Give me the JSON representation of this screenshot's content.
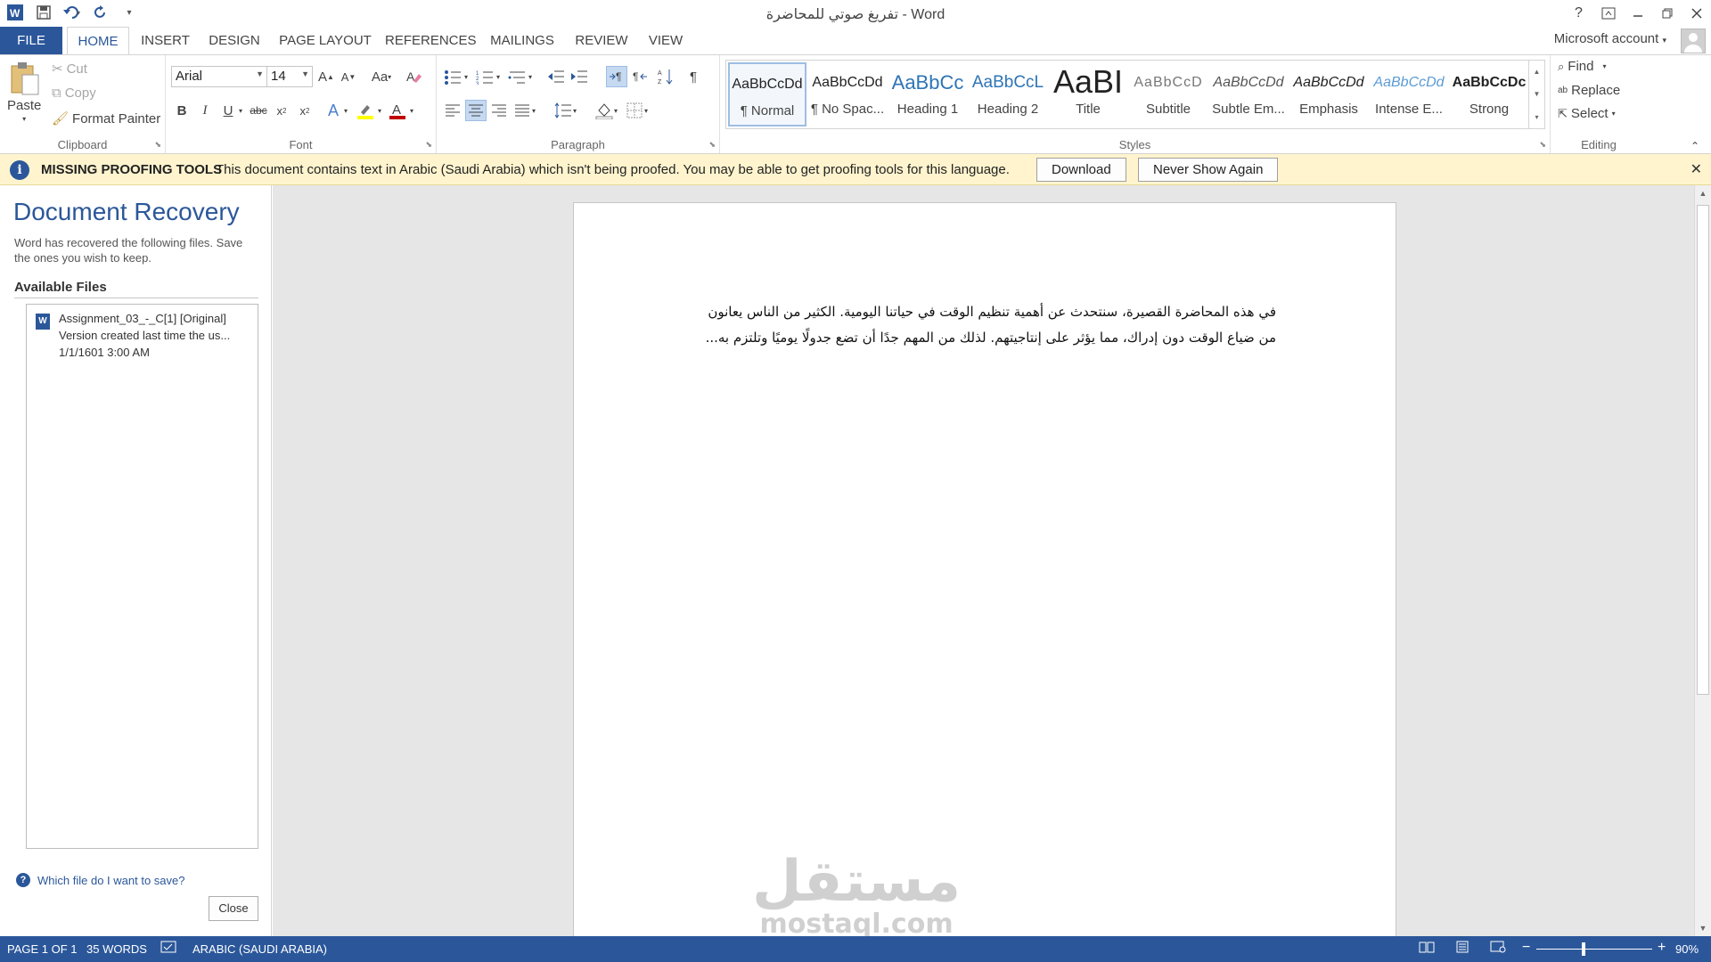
{
  "window": {
    "title": "تفريغ صوتي للمحاضرة - Word",
    "help": "?",
    "controls": [
      "restore-ribbon",
      "minimize",
      "maximize",
      "close"
    ]
  },
  "tabs": {
    "file": "FILE",
    "home": "HOME",
    "insert": "INSERT",
    "design": "DESIGN",
    "page_layout": "PAGE LAYOUT",
    "references": "REFERENCES",
    "mailings": "MAILINGS",
    "review": "REVIEW",
    "view": "VIEW",
    "account": "Microsoft account"
  },
  "clipboard": {
    "paste": "Paste",
    "cut": "Cut",
    "copy": "Copy",
    "format_painter": "Format Painter",
    "label": "Clipboard"
  },
  "font": {
    "name": "Arial",
    "size": "14",
    "case": "Aa",
    "label": "Font"
  },
  "paragraph": {
    "label": "Paragraph"
  },
  "styles": {
    "label": "Styles",
    "items": [
      {
        "preview": "AaBbCcDd",
        "name": "¶ Normal"
      },
      {
        "preview": "AaBbCcDd",
        "name": "¶ No Spac..."
      },
      {
        "preview": "AaBbCc",
        "name": "Heading 1"
      },
      {
        "preview": "AaBbCcL",
        "name": "Heading 2"
      },
      {
        "preview": "AaBI",
        "name": "Title"
      },
      {
        "preview": "AaBbCcD",
        "name": "Subtitle"
      },
      {
        "preview": "AaBbCcDd",
        "name": "Subtle Em..."
      },
      {
        "preview": "AaBbCcDd",
        "name": "Emphasis"
      },
      {
        "preview": "AaBbCcDd",
        "name": "Intense E..."
      },
      {
        "preview": "AaBbCcDc",
        "name": "Strong"
      }
    ]
  },
  "editing": {
    "find": "Find",
    "replace": "Replace",
    "select": "Select",
    "label": "Editing"
  },
  "infobar": {
    "title": "MISSING PROOFING TOOLS",
    "message": "This document contains text in Arabic (Saudi Arabia) which isn't being proofed. You may be able to get proofing tools for this language.",
    "download": "Download",
    "never_show": "Never Show Again"
  },
  "recovery": {
    "title": "Document Recovery",
    "description": "Word has recovered the following files.  Save the ones you wish to keep.",
    "available": "Available Files",
    "file": {
      "name": "Assignment_03_-_C[1]  [Original]",
      "version": "Version created last time the us...",
      "date": "1/1/1601 3:00 AM"
    },
    "help": "Which file do I want to save?",
    "close": "Close"
  },
  "document": {
    "paragraph": "في هذه المحاضرة القصيرة، سنتحدث عن أهمية تنظيم الوقت في حياتنا اليومية. الكثير من الناس يعانون من ضياع الوقت دون إدراك، مما يؤثر على إنتاجيتهم. لذلك من المهم جدًا أن تضع جدولًا يوميًا وتلتزم به..."
  },
  "watermark": {
    "arabic": "مستقل",
    "latin": "mostaql.com"
  },
  "status": {
    "page": "PAGE 1 OF 1",
    "words": "35 WORDS",
    "language": "ARABIC (SAUDI ARABIA)",
    "zoom": "90%",
    "zoom_minus": "−",
    "zoom_plus": "+"
  },
  "colors": {
    "accent": "#2b579a",
    "infobar": "#fff4ce",
    "status": "#2b579a"
  }
}
